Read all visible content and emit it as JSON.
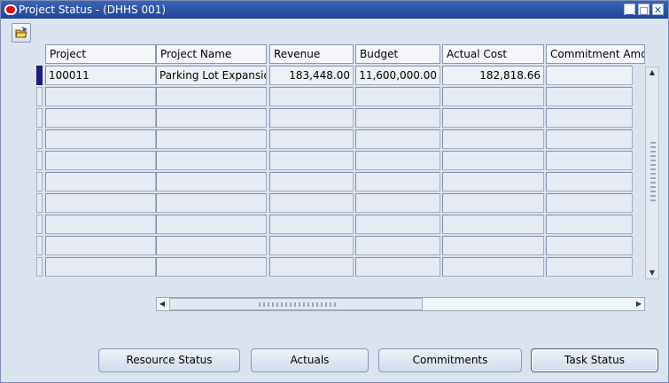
{
  "window": {
    "title": "Project Status - (DHHS 001)",
    "controls": {
      "minimize": "▁",
      "maximize": "□",
      "close": "✕"
    }
  },
  "toolbar": {
    "open_icon": "folder-open-icon"
  },
  "table": {
    "columns": [
      "Project",
      "Project Name",
      "Revenue",
      "Budget",
      "Actual Cost",
      "Commitment Amou"
    ],
    "rows": [
      [
        "100011",
        "Parking Lot Expansio",
        "183,448.00",
        "11,600,000.00",
        "182,818.66",
        ""
      ]
    ]
  },
  "buttons": {
    "resource_status": "Resource Status",
    "actuals": "Actuals",
    "commitments": "Commitments",
    "task_status": "Task Status"
  },
  "colors": {
    "titlebar": "#2a4fa5",
    "background": "#dbe3ef",
    "current_row_indicator": "#1c1f7a"
  }
}
